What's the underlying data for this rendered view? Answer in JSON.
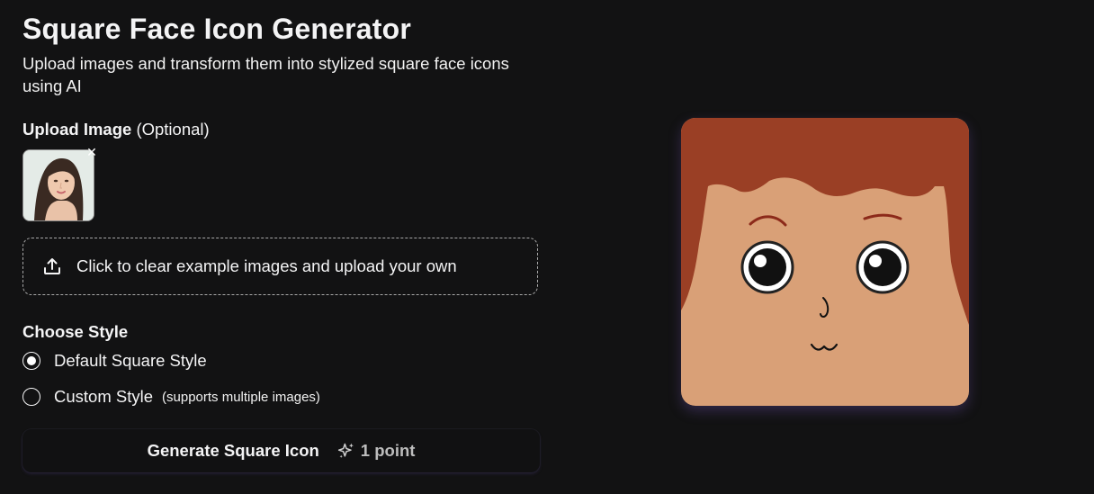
{
  "header": {
    "title": "Square Face Icon Generator",
    "subtitle": "Upload images and transform them into stylized square face icons using AI"
  },
  "upload": {
    "label_bold": "Upload Image",
    "label_extra": "(Optional)",
    "thumbnail_icon": "portrait-photo",
    "remove_icon": "close-icon",
    "dropzone_text": "Click to clear example images and upload your own",
    "dropzone_icon": "upload-icon"
  },
  "style": {
    "heading": "Choose Style",
    "options": [
      {
        "label": "Default Square Style",
        "note": "",
        "selected": true
      },
      {
        "label": "Custom Style",
        "note": "(supports multiple images)",
        "selected": false
      }
    ]
  },
  "generate": {
    "label": "Generate Square Icon",
    "cost_icon": "sparkle-icon",
    "cost": "1 point"
  },
  "preview": {
    "icon": "square-face-icon"
  },
  "colors": {
    "background": "#121213",
    "text": "#f4f4f5",
    "face_skin": "#d9a077",
    "face_hair": "#9a3f25",
    "eyebrow": "#8c2a1a"
  }
}
